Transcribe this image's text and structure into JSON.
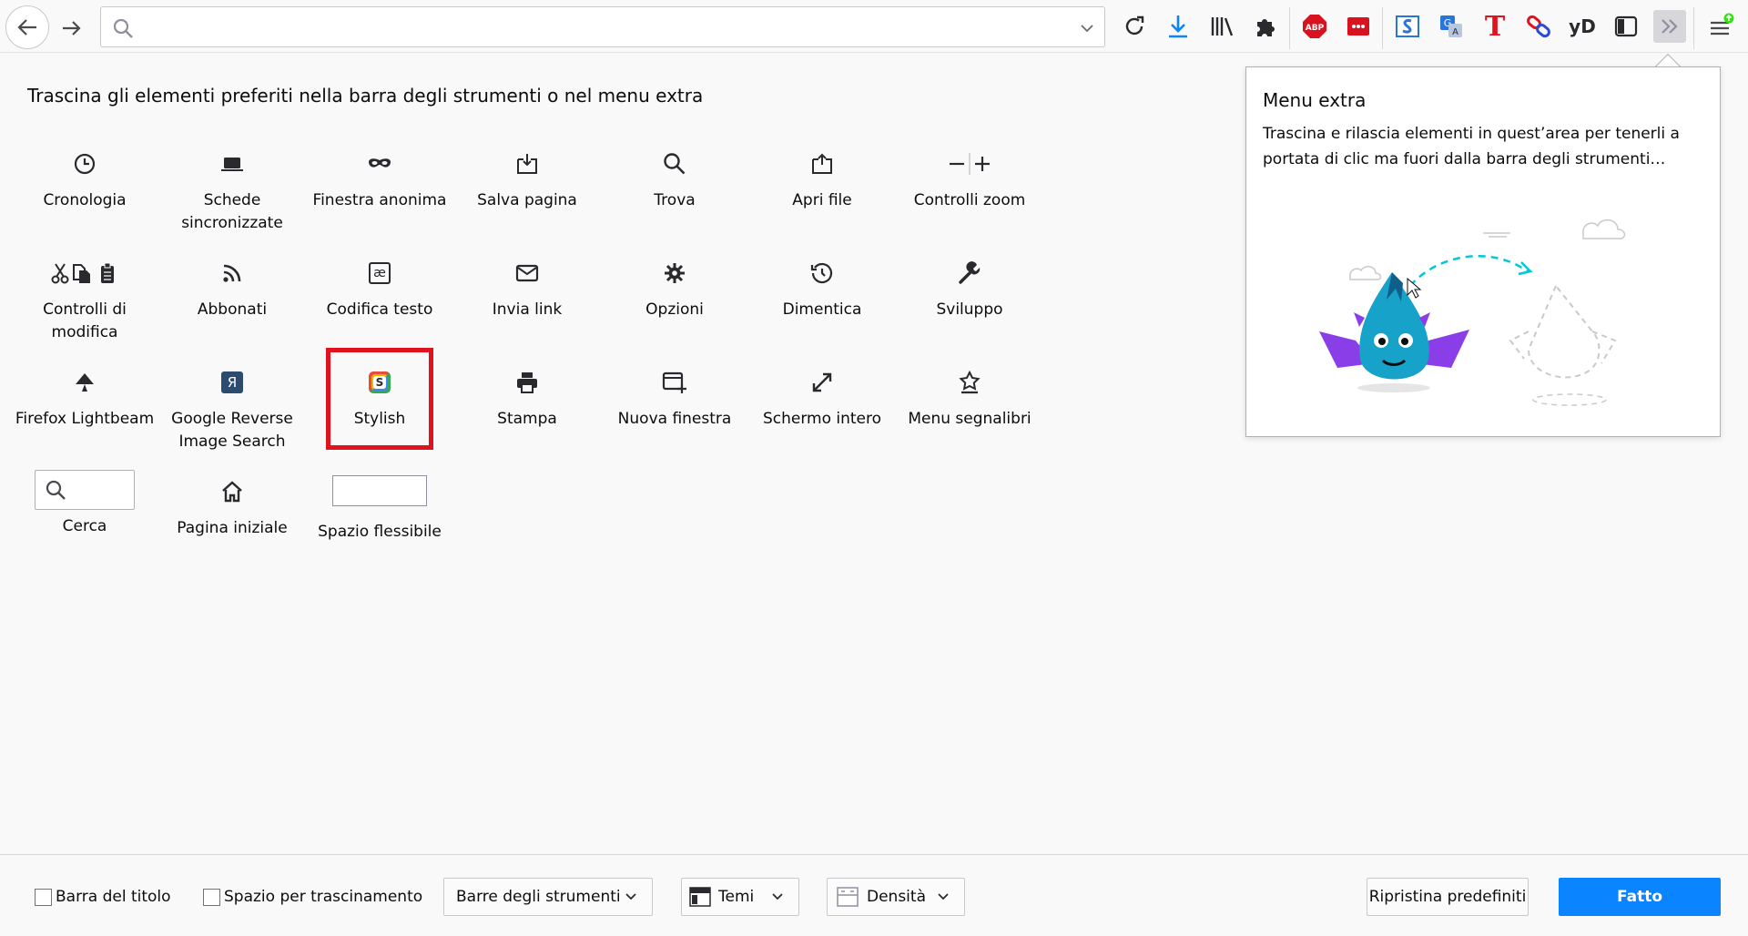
{
  "toolbar": {
    "url_value": "",
    "colors": {
      "download": "#0a84ff",
      "abp": "#d8121e",
      "lastpass": "#d8121e",
      "translate": "#2a75d9",
      "stylus_T": "#e0121e"
    },
    "ext_labels": {
      "abp": "ABP",
      "yd": "yD",
      "tt": "T"
    }
  },
  "heading": "Trascina gli elementi preferiti nella barra degli strumenti o nel menu extra",
  "palette": {
    "items": [
      {
        "label": "Cronologia",
        "icon": "clock-icon"
      },
      {
        "label": "Schede sincronizzate",
        "icon": "laptop-icon"
      },
      {
        "label": "Finestra anonima",
        "icon": "mask-icon"
      },
      {
        "label": "Salva pagina",
        "icon": "save-page-icon"
      },
      {
        "label": "Trova",
        "icon": "search-icon"
      },
      {
        "label": "Apri file",
        "icon": "folder-open-icon"
      },
      {
        "label": "Controlli zoom",
        "icon": "zoom-icon"
      },
      {
        "label": "Controlli di modifica",
        "icon": "cut-copy-paste-icon"
      },
      {
        "label": "Abbonati",
        "icon": "rss-icon"
      },
      {
        "label": "Codifica testo",
        "icon": "text-encoding-icon"
      },
      {
        "label": "Invia link",
        "icon": "mail-icon"
      },
      {
        "label": "Opzioni",
        "icon": "gear-icon"
      },
      {
        "label": "Dimentica",
        "icon": "forget-icon"
      },
      {
        "label": "Sviluppo",
        "icon": "wrench-icon"
      },
      {
        "label": "Firefox Lightbeam",
        "icon": "lightbeam-icon"
      },
      {
        "label": "Google Reverse Image Search",
        "icon": "reverse-search-icon"
      },
      {
        "label": "Stylish",
        "icon": "stylish-icon"
      },
      {
        "label": "Stampa",
        "icon": "printer-icon"
      },
      {
        "label": "Nuova finestra",
        "icon": "new-window-icon"
      },
      {
        "label": "Schermo intero",
        "icon": "fullscreen-icon"
      },
      {
        "label": "Menu segnalibri",
        "icon": "bookmark-star-icon"
      },
      {
        "label": "Cerca",
        "icon": "search-box-icon"
      },
      {
        "label": "Pagina iniziale",
        "icon": "home-icon"
      },
      {
        "label": "Spazio flessibile",
        "icon": "flexible-space-icon"
      }
    ],
    "stylish_glyph": "S",
    "reverse_glyph": "Я",
    "encoding_glyph": "æ"
  },
  "overflow_panel": {
    "title": "Menu extra",
    "description": "Trascina e rilascia elementi in quest’area per tenerli a portata di clic ma fuori dalla barra degli strumenti…"
  },
  "footer": {
    "title_bar_label": "Barra del titolo",
    "drag_space_label": "Spazio per trascinamento",
    "toolbars_label": "Barre degli strumenti",
    "themes_label": "Temi",
    "density_label": "Densità",
    "restore_label": "Ripristina predefiniti",
    "done_label": "Fatto"
  }
}
